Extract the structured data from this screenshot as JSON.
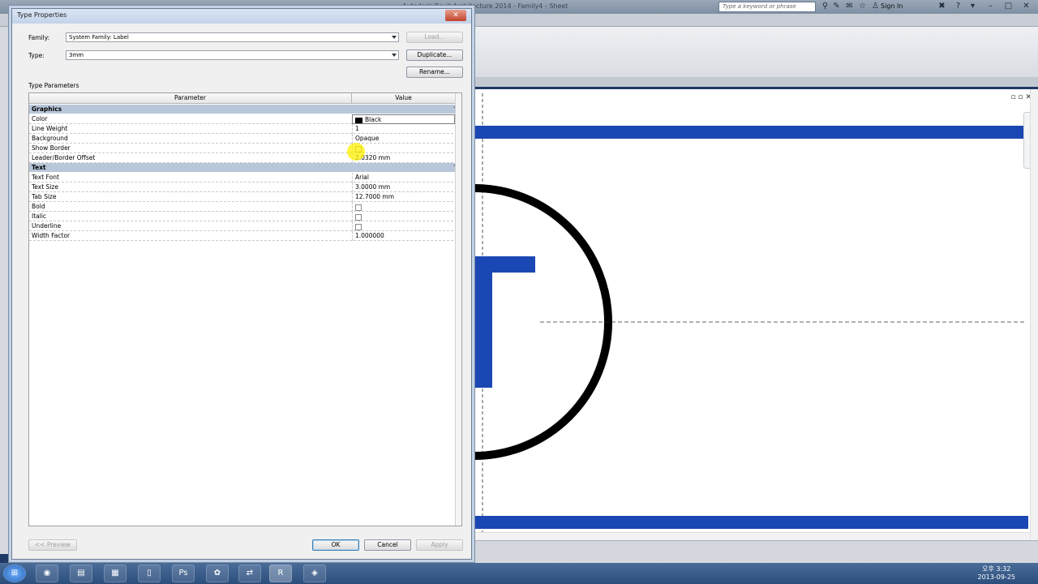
{
  "app": {
    "title": "Autodesk Revit Architecture 2014  -  Family4 - Sheet",
    "search_placeholder": "Type a keyword or phrase",
    "sign_in": "Sign In"
  },
  "dialog": {
    "title": "Type Properties",
    "family_label": "Family:",
    "family_value": "System Family: Label",
    "type_label": "Type:",
    "type_value": "3mm",
    "buttons": {
      "load": "Load...",
      "duplicate": "Duplicate...",
      "rename": "Rename..."
    },
    "type_params_label": "Type Parameters",
    "columns": {
      "parameter": "Parameter",
      "value": "Value"
    },
    "groups": [
      {
        "name": "Graphics",
        "rows": [
          {
            "param": "Color",
            "value": "Black",
            "kind": "color"
          },
          {
            "param": "Line Weight",
            "value": "1",
            "kind": "text"
          },
          {
            "param": "Background",
            "value": "Opaque",
            "kind": "text"
          },
          {
            "param": "Show Border",
            "value": "",
            "kind": "checkbox"
          },
          {
            "param": "Leader/Border Offset",
            "value": "2.0320 mm",
            "kind": "text"
          }
        ]
      },
      {
        "name": "Text",
        "rows": [
          {
            "param": "Text Font",
            "value": "Arial",
            "kind": "text"
          },
          {
            "param": "Text Size",
            "value": "3.0000 mm",
            "kind": "text"
          },
          {
            "param": "Tab Size",
            "value": "12.7000 mm",
            "kind": "text"
          },
          {
            "param": "Bold",
            "value": "",
            "kind": "checkbox"
          },
          {
            "param": "Italic",
            "value": "",
            "kind": "checkbox"
          },
          {
            "param": "Underline",
            "value": "",
            "kind": "checkbox"
          },
          {
            "param": "Width Factor",
            "value": "1.000000",
            "kind": "text"
          }
        ]
      }
    ],
    "footer": {
      "preview": "<< Preview",
      "ok": "OK",
      "cancel": "Cancel",
      "apply": "Apply"
    }
  },
  "clock": {
    "time": "오후 3:32",
    "date": "2013-09-25"
  },
  "colors": {
    "accent_blue": "#1a47b3",
    "group_header": "#b8c7d9"
  }
}
